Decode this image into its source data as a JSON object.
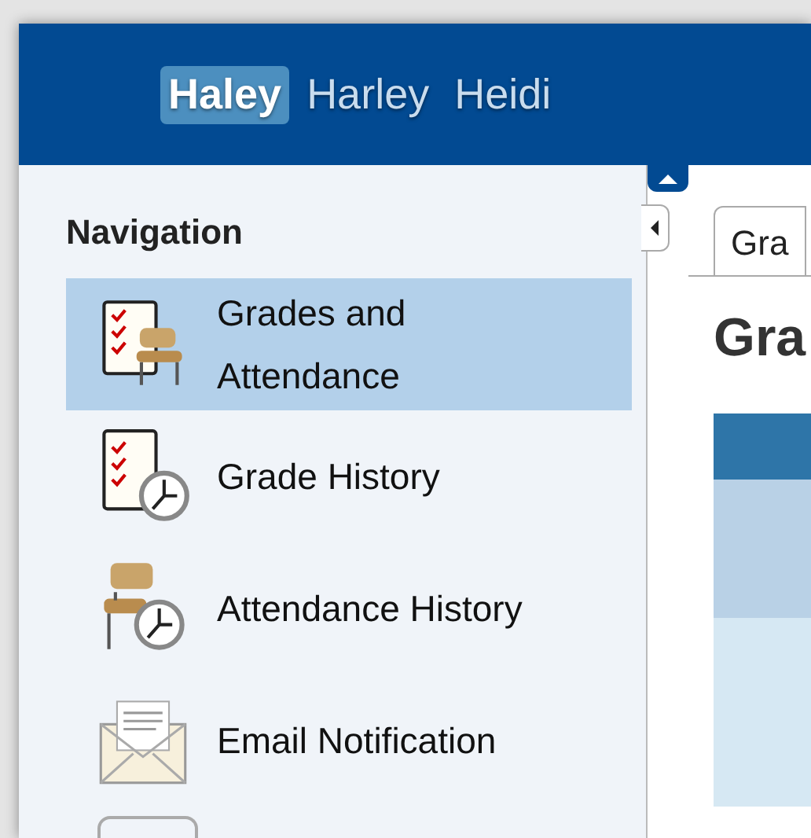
{
  "header": {
    "users": [
      {
        "name": "Haley",
        "selected": true
      },
      {
        "name": "Harley",
        "selected": false
      },
      {
        "name": "Heidi",
        "selected": false
      }
    ]
  },
  "sidebar": {
    "title": "Navigation",
    "items": [
      {
        "label": "Grades and Attendance",
        "kind": "grades-attendance",
        "selected": true
      },
      {
        "label": "Grade History",
        "kind": "grade-history",
        "selected": false
      },
      {
        "label": "Attendance History",
        "kind": "attendance-history",
        "selected": false
      },
      {
        "label": "Email Notification",
        "kind": "email",
        "selected": false
      }
    ]
  },
  "content": {
    "tabs": [
      {
        "label": "Gra"
      }
    ],
    "heading": "Gra"
  }
}
